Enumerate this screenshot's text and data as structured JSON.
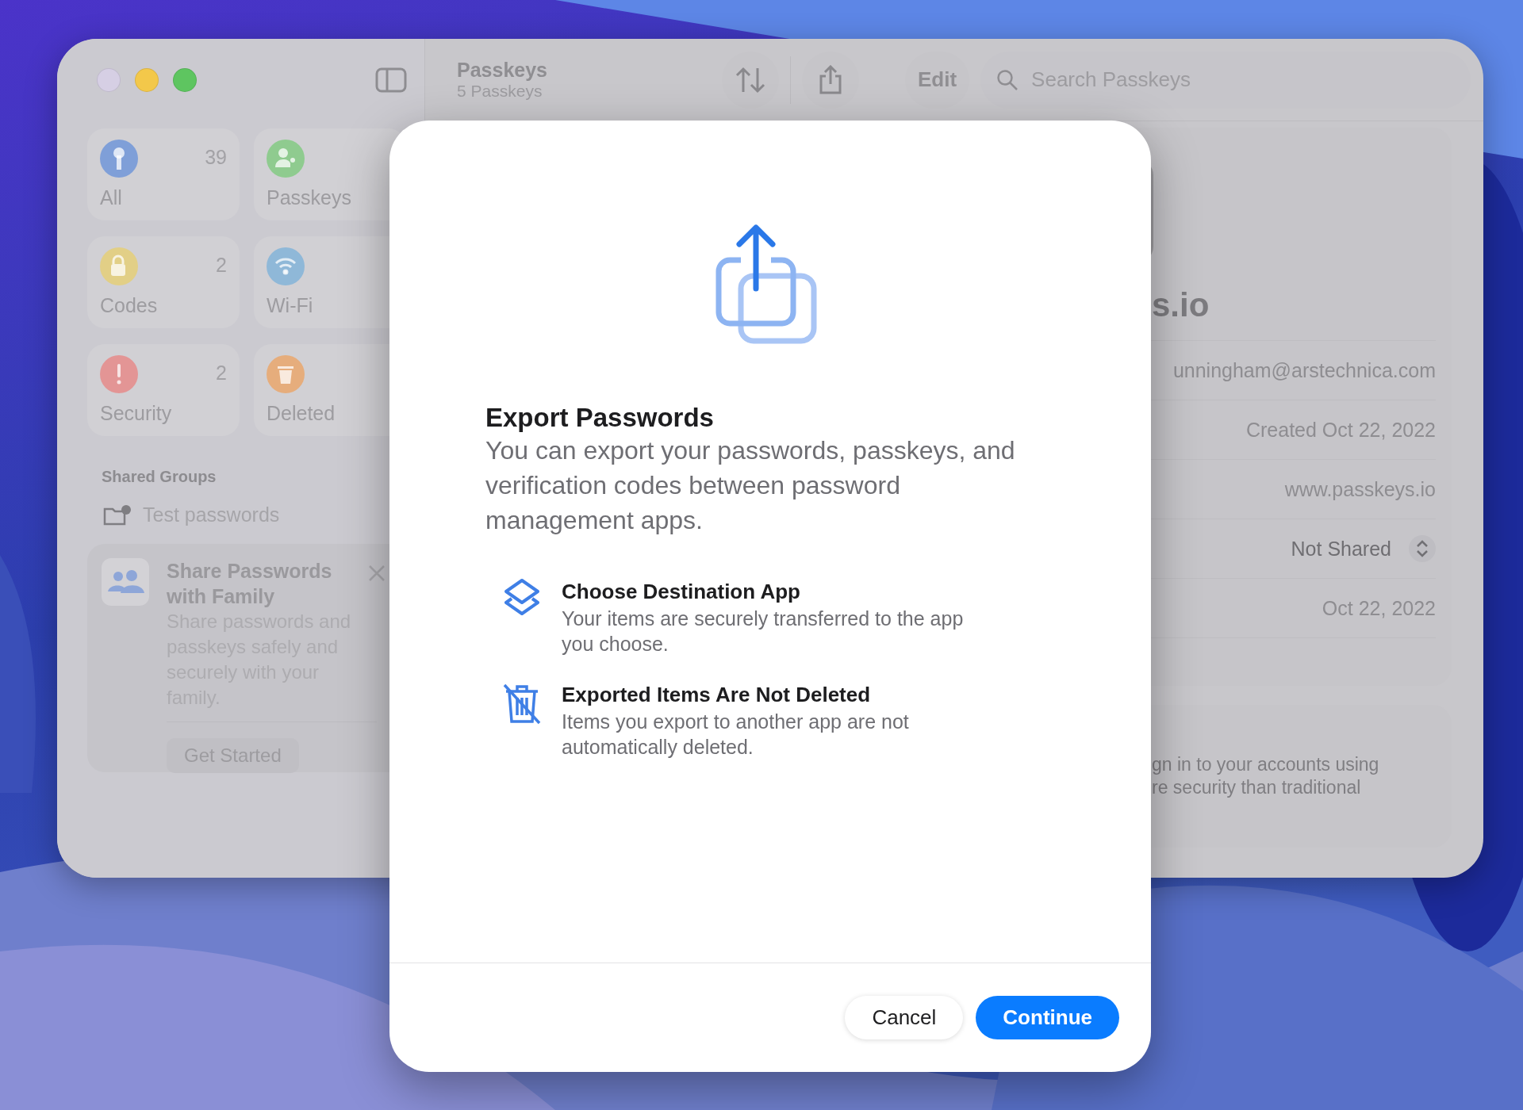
{
  "window": {
    "title": "Passkeys",
    "subtitle": "5 Passkeys",
    "edit_button": "Edit",
    "search": {
      "placeholder": "Search Passkeys"
    }
  },
  "sidebar": {
    "categories": [
      {
        "label": "All",
        "count": "39",
        "color": "#7f9fd8"
      },
      {
        "label": "Passkeys",
        "color": "#8fcb8f"
      },
      {
        "label": "Codes",
        "count": "2",
        "color": "#e2cf86"
      },
      {
        "label": "Wi-Fi",
        "color": "#8fb8d8"
      },
      {
        "label": "Security",
        "count": "2",
        "color": "#e39595"
      },
      {
        "label": "Deleted",
        "color": "#e6ad7c"
      }
    ],
    "shared_groups": {
      "heading": "Shared Groups",
      "items": [
        {
          "label": "Test passwords"
        }
      ]
    },
    "promo": {
      "title": "Share Passwords with Family",
      "body": "Share passwords and passkeys safely and securely with your family.",
      "button": "Get Started"
    }
  },
  "detail": {
    "title": "s.io",
    "fields": [
      {
        "kind": "text",
        "value": "unningham@arstechnica.com"
      },
      {
        "kind": "text",
        "value": "Created Oct 22, 2022"
      },
      {
        "kind": "text",
        "value": "www.passkeys.io"
      },
      {
        "kind": "popup",
        "value": "Not Shared"
      },
      {
        "kind": "text",
        "value": "Oct 22, 2022"
      }
    ],
    "info_lines": [
      "gn in to your accounts using",
      "re security than traditional"
    ]
  },
  "dialog": {
    "title": "Export Passwords",
    "message": "You can export your passwords, passkeys, and verification codes between password management apps.",
    "items": [
      {
        "title": "Choose Destination App",
        "text": "Your items are securely transferred to the app you choose."
      },
      {
        "title": "Exported Items Are Not Deleted",
        "text": "Items you export to another app are not automatically deleted."
      }
    ],
    "buttons": [
      {
        "label": "Cancel",
        "default": false
      },
      {
        "label": "Continue",
        "default": true
      }
    ]
  }
}
